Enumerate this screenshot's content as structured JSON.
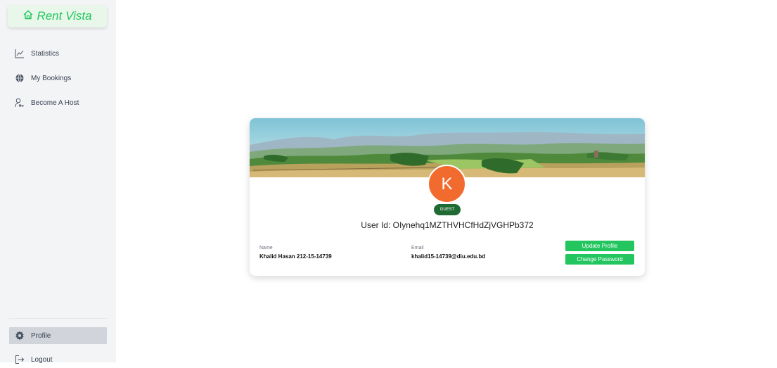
{
  "brand": {
    "name": "Rent Vista",
    "icon": "home-icon",
    "accent": "#22c55e"
  },
  "sidebar": {
    "items": [
      {
        "label": "Statistics",
        "icon": "line-chart-icon"
      },
      {
        "label": "My Bookings",
        "icon": "globe-icon"
      },
      {
        "label": "Become A Host",
        "icon": "user-key-icon"
      }
    ],
    "bottom": [
      {
        "label": "Profile",
        "icon": "gear-icon",
        "active": true
      },
      {
        "label": "Logout",
        "icon": "logout-icon"
      }
    ]
  },
  "profile": {
    "avatar_initial": "K",
    "role": "GUEST",
    "user_id": "User Id: OIynehq1MZTHVHCfHdZjVGHPb372",
    "name_label": "Name",
    "name_value": "Khalid Hasan 212-15-14739",
    "email_label": "Email",
    "email_value": "khalid15-14739@diu.edu.bd",
    "update_button": "Update Profile",
    "password_button": "Change Password",
    "avatar_color": "#f26b2e",
    "badge_color": "#1f6b33"
  }
}
